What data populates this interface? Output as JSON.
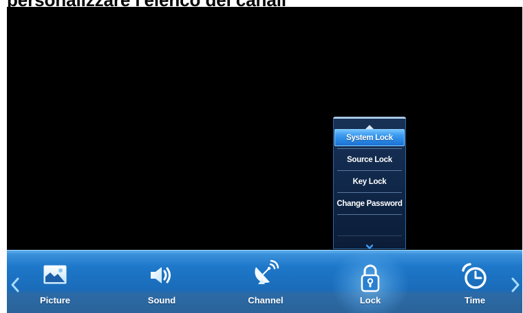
{
  "caption": "personalizzare l'elenco dei canali",
  "colors": {
    "page_background": "#ffffff",
    "screen_background": "#000000",
    "menu_bar_blue": "#1d75c6",
    "selected_item_blue": "#2b8ae6",
    "popup_background": "#10284a",
    "text": "#ffffff"
  },
  "lock_menu": {
    "scroll_up_icon": "triangle-up-icon",
    "items": [
      {
        "label": "System Lock",
        "selected": true
      },
      {
        "label": "Source Lock",
        "selected": false
      },
      {
        "label": "Key Lock",
        "selected": false
      },
      {
        "label": "Change Password",
        "selected": false
      }
    ],
    "scroll_down_icon": "chevron-down-icon"
  },
  "menu_bar": {
    "prev_icon": "chevron-left-icon",
    "items": [
      {
        "label": "Picture",
        "icon": "picture-icon",
        "active": false
      },
      {
        "label": "Sound",
        "icon": "speaker-icon",
        "active": false
      },
      {
        "label": "Channel",
        "icon": "satellite-dish-icon",
        "active": false
      },
      {
        "label": "Lock",
        "icon": "lock-icon",
        "active": true
      },
      {
        "label": "Time",
        "icon": "alarm-clock-icon",
        "active": false
      }
    ],
    "next_icon": "chevron-right-icon"
  }
}
